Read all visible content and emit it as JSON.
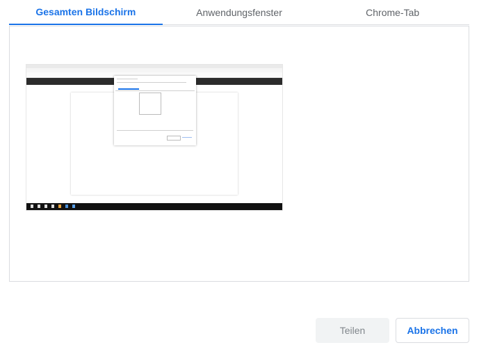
{
  "tabs": [
    {
      "label": "Gesamten Bildschirm",
      "active": true
    },
    {
      "label": "Anwendungsfenster",
      "active": false
    },
    {
      "label": "Chrome-Tab",
      "active": false
    }
  ],
  "buttons": {
    "share_label": "Teilen",
    "cancel_label": "Abbrechen"
  },
  "colors": {
    "accent": "#1a73e8",
    "share_bg": "#f1f3f4",
    "share_text": "#80868b"
  }
}
